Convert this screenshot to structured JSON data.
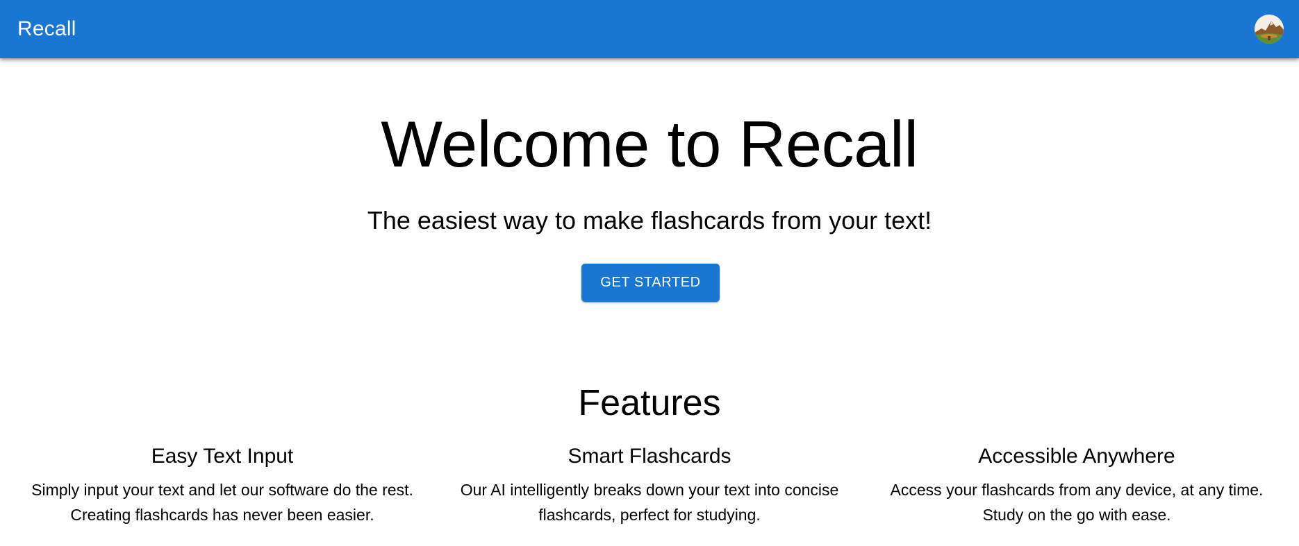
{
  "appbar": {
    "brand": "Recall",
    "avatar_icon": "user-avatar-icon",
    "color": "#1976d2"
  },
  "hero": {
    "title": "Welcome to Recall",
    "subtitle": "The easiest way to make flashcards from your text!",
    "cta_label": "GET STARTED"
  },
  "features": {
    "title": "Features",
    "items": [
      {
        "title": "Easy Text Input",
        "description": "Simply input your text and let our software do the rest. Creating flashcards has never been easier."
      },
      {
        "title": "Smart Flashcards",
        "description": "Our AI intelligently breaks down your text into concise flashcards, perfect for studying."
      },
      {
        "title": "Accessible Anywhere",
        "description": "Access your flashcards from any device, at any time. Study on the go with ease."
      }
    ]
  }
}
